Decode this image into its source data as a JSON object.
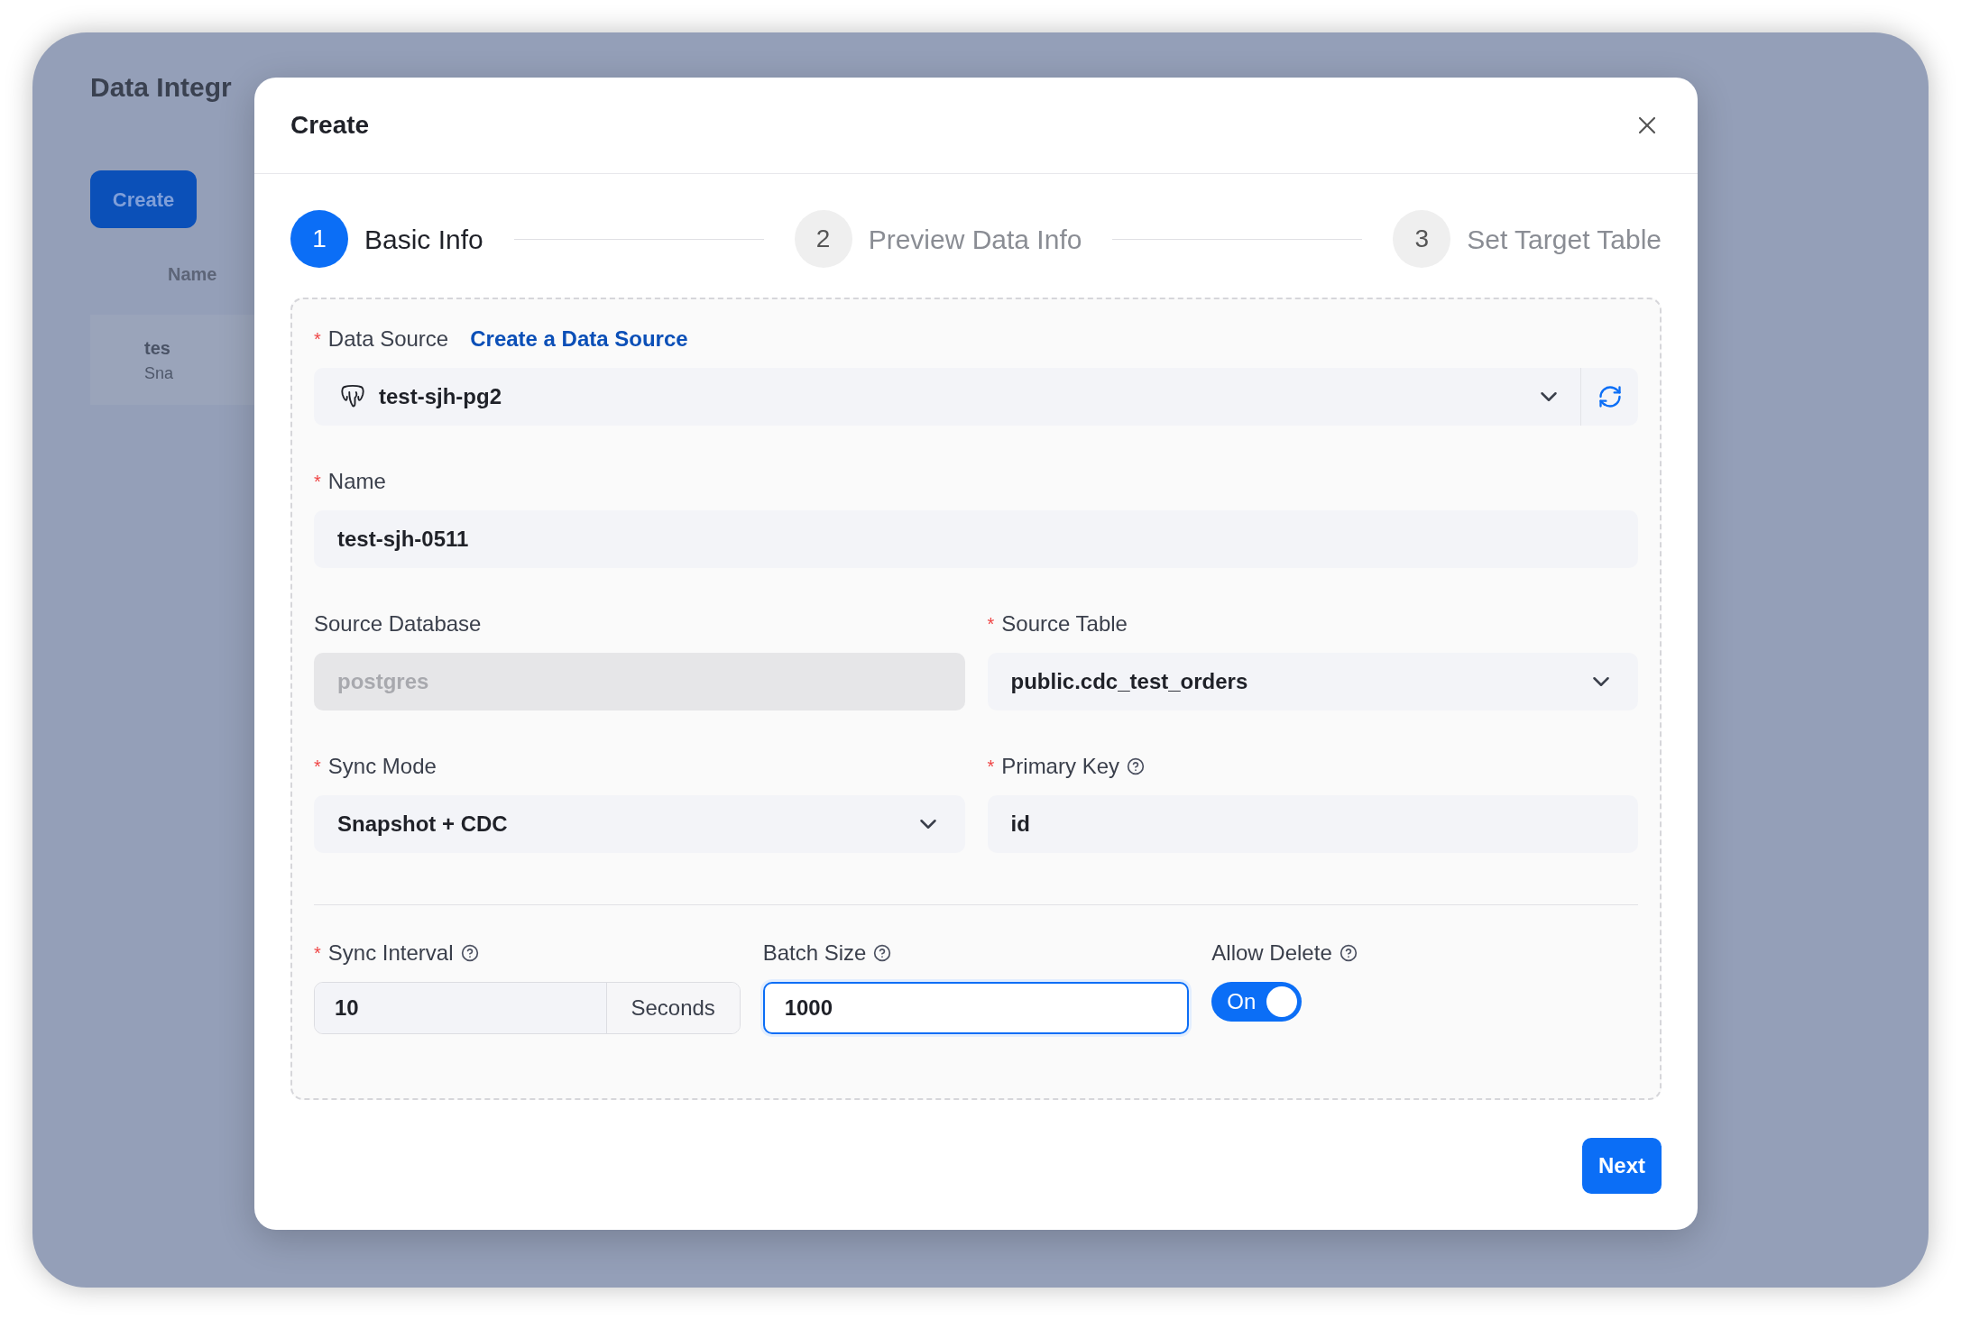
{
  "background": {
    "title": "Data Integr",
    "create_button": "Create",
    "table_header": "Name",
    "row_name": "tes",
    "row_subtitle": "Sna"
  },
  "modal": {
    "title": "Create",
    "next_button": "Next"
  },
  "steps": [
    {
      "number": "1",
      "label": "Basic Info",
      "selected": true
    },
    {
      "number": "2",
      "label": "Preview Data Info",
      "selected": false
    },
    {
      "number": "3",
      "label": "Set Target Table",
      "selected": false
    }
  ],
  "form": {
    "data_source": {
      "label": "Data Source",
      "required_mark": "*",
      "link": "Create a Data Source",
      "value": "test-sjh-pg2"
    },
    "name": {
      "label": "Name",
      "required_mark": "*",
      "value": "test-sjh-0511"
    },
    "source_database": {
      "label": "Source Database",
      "value": "postgres",
      "disabled": true
    },
    "source_table": {
      "label": "Source Table",
      "required_mark": "*",
      "value": "public.cdc_test_orders"
    },
    "sync_mode": {
      "label": "Sync Mode",
      "required_mark": "*",
      "value": "Snapshot + CDC"
    },
    "primary_key": {
      "label": "Primary Key",
      "required_mark": "*",
      "help": true,
      "value": "id"
    },
    "sync_interval": {
      "label": "Sync Interval",
      "required_mark": "*",
      "help": true,
      "value": "10",
      "unit": "Seconds"
    },
    "batch_size": {
      "label": "Batch Size",
      "help": true,
      "value": "1000",
      "focused": true
    },
    "allow_delete": {
      "label": "Allow Delete",
      "help": true,
      "on": true,
      "toggle_label": "On"
    }
  }
}
